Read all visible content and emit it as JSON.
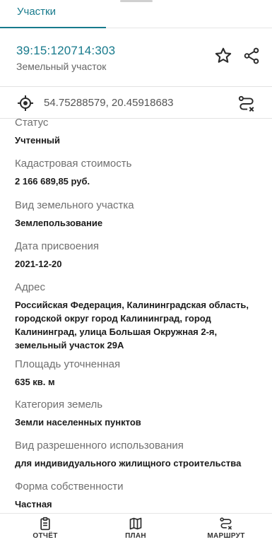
{
  "tabs": {
    "active_label": "Участки"
  },
  "header": {
    "cadastral_number": "39:15:120714:303",
    "object_type": "Земельный участок"
  },
  "coords": {
    "text": "54.75288579, 20.45918683"
  },
  "fields": [
    {
      "label": "Статус",
      "value": "Учтенный"
    },
    {
      "label": "Кадастровая стоимость",
      "value": "2 166 689,85 руб."
    },
    {
      "label": "Вид земельного участка",
      "value": "Землепользование"
    },
    {
      "label": "Дата присвоения",
      "value": "2021-12-20"
    },
    {
      "label": "Адрес",
      "value": "Российская Федерация, Калининградская область, городской округ город Калининград, город Калининград, улица Большая Окружная 2-я, земельный участок 29А"
    },
    {
      "label": "Площадь уточненная",
      "value": "635 кв. м"
    },
    {
      "label": "Категория земель",
      "value": "Земли населенных пунктов"
    },
    {
      "label": "Вид разрешенного использования",
      "value": "для индивидуального жилищного строительства"
    },
    {
      "label": "Форма собственности",
      "value": "Частная"
    }
  ],
  "bottom_nav": {
    "report_label": "ОТЧЁТ",
    "plan_label": "ПЛАН",
    "route_label": "МАРШРУТ"
  },
  "colors": {
    "accent": "#177a8c"
  },
  "icons": [
    "star-icon",
    "share-icon",
    "target-icon",
    "route-icon",
    "report-icon",
    "map-icon"
  ]
}
